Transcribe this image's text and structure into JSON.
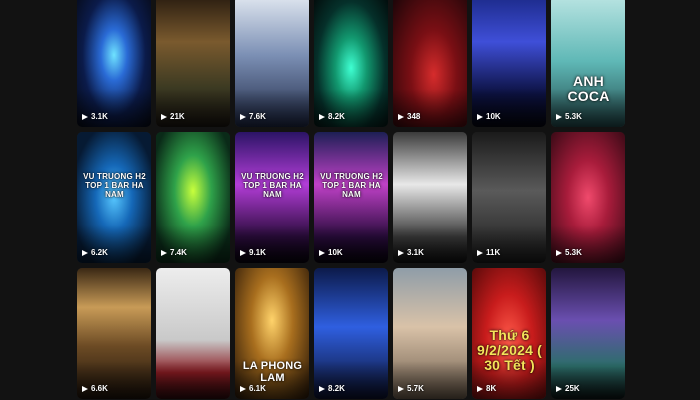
{
  "videos": [
    {
      "views": "3.1K",
      "overlay": "",
      "style": "club-blue"
    },
    {
      "views": "21K",
      "overlay": "",
      "style": "bar-green"
    },
    {
      "views": "7.6K",
      "overlay": "",
      "style": "club-white"
    },
    {
      "views": "8.2K",
      "overlay": "",
      "style": "club-cyan"
    },
    {
      "views": "348",
      "overlay": "",
      "style": "dj-red"
    },
    {
      "views": "10K",
      "overlay": "",
      "style": "club-crowd"
    },
    {
      "views": "5.3K",
      "overlay": "ANH COCA",
      "style": "poster-teal"
    },
    {
      "views": "6.2K",
      "overlay": "VU TRUONG H2 TOP 1 BAR HA NAM",
      "style": "stage-blue"
    },
    {
      "views": "7.4K",
      "overlay": "",
      "style": "stage-yellow"
    },
    {
      "views": "9.1K",
      "overlay": "VU TRUONG H2 TOP 1 BAR HA NAM",
      "style": "stage-pink"
    },
    {
      "views": "10K",
      "overlay": "VU TRUONG H2 TOP 1 BAR HA NAM",
      "style": "stage-pink2"
    },
    {
      "views": "3.1K",
      "overlay": "",
      "style": "poster-bw"
    },
    {
      "views": "11K",
      "overlay": "",
      "style": "poster-dark"
    },
    {
      "views": "5.3K",
      "overlay": "",
      "style": "man-red"
    },
    {
      "views": "6.6K",
      "overlay": "",
      "style": "gold-grid"
    },
    {
      "views": "",
      "overlay": "",
      "style": "white-person"
    },
    {
      "views": "6.1K",
      "overlay": "LA PHONG LAM",
      "style": "gold-poster"
    },
    {
      "views": "8.2K",
      "overlay": "",
      "style": "club-lasers"
    },
    {
      "views": "5.7K",
      "overlay": "",
      "style": "selfie"
    },
    {
      "views": "8K",
      "overlay": "Thứ 6 9/2/2024 ( 30 Tết )",
      "style": "tet-red"
    },
    {
      "views": "25K",
      "overlay": "",
      "style": "venue-purple"
    }
  ]
}
